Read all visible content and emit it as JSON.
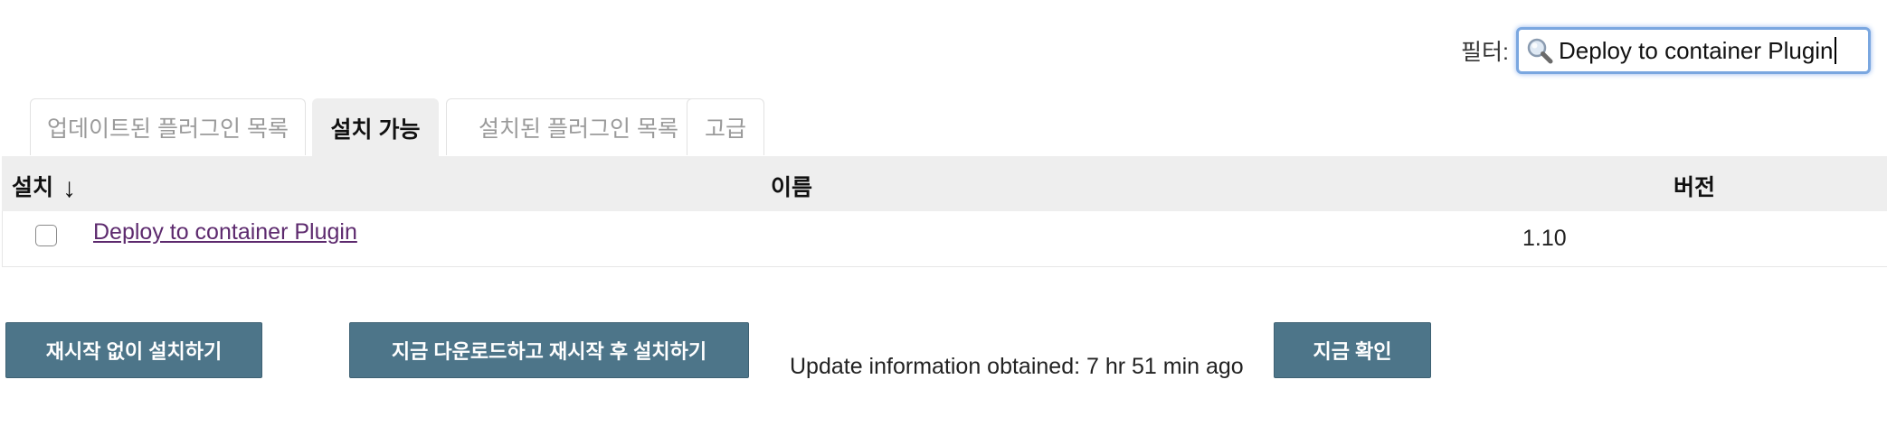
{
  "filter": {
    "label": "필터:",
    "value": "Deploy to container Plugin"
  },
  "tabs": [
    {
      "label": "업데이트된 플러그인 목록",
      "active": false
    },
    {
      "label": "설치 가능",
      "active": true
    },
    {
      "label": "설치된 플러그인 목록",
      "active": false
    },
    {
      "label": "고급",
      "active": false
    }
  ],
  "table": {
    "columns": {
      "install": "설치",
      "sort_indicator": "↓",
      "name": "이름",
      "version": "버전"
    },
    "rows": [
      {
        "name": "Deploy to container Plugin",
        "version": "1.10",
        "checked": false
      }
    ]
  },
  "actions": {
    "install_without_restart": "재시작 없이 설치하기",
    "download_and_install_after_restart": "지금 다운로드하고 재시작 후 설치하기",
    "update_info": "Update information obtained: 7 hr 51 min ago",
    "check_now": "지금 확인"
  },
  "colors": {
    "button_bg": "#4d7589",
    "link": "#5d2a6e",
    "header_bg": "#eeeeee",
    "filter_focus": "#7aa7e0"
  },
  "icons": {
    "filter": "search-icon"
  }
}
